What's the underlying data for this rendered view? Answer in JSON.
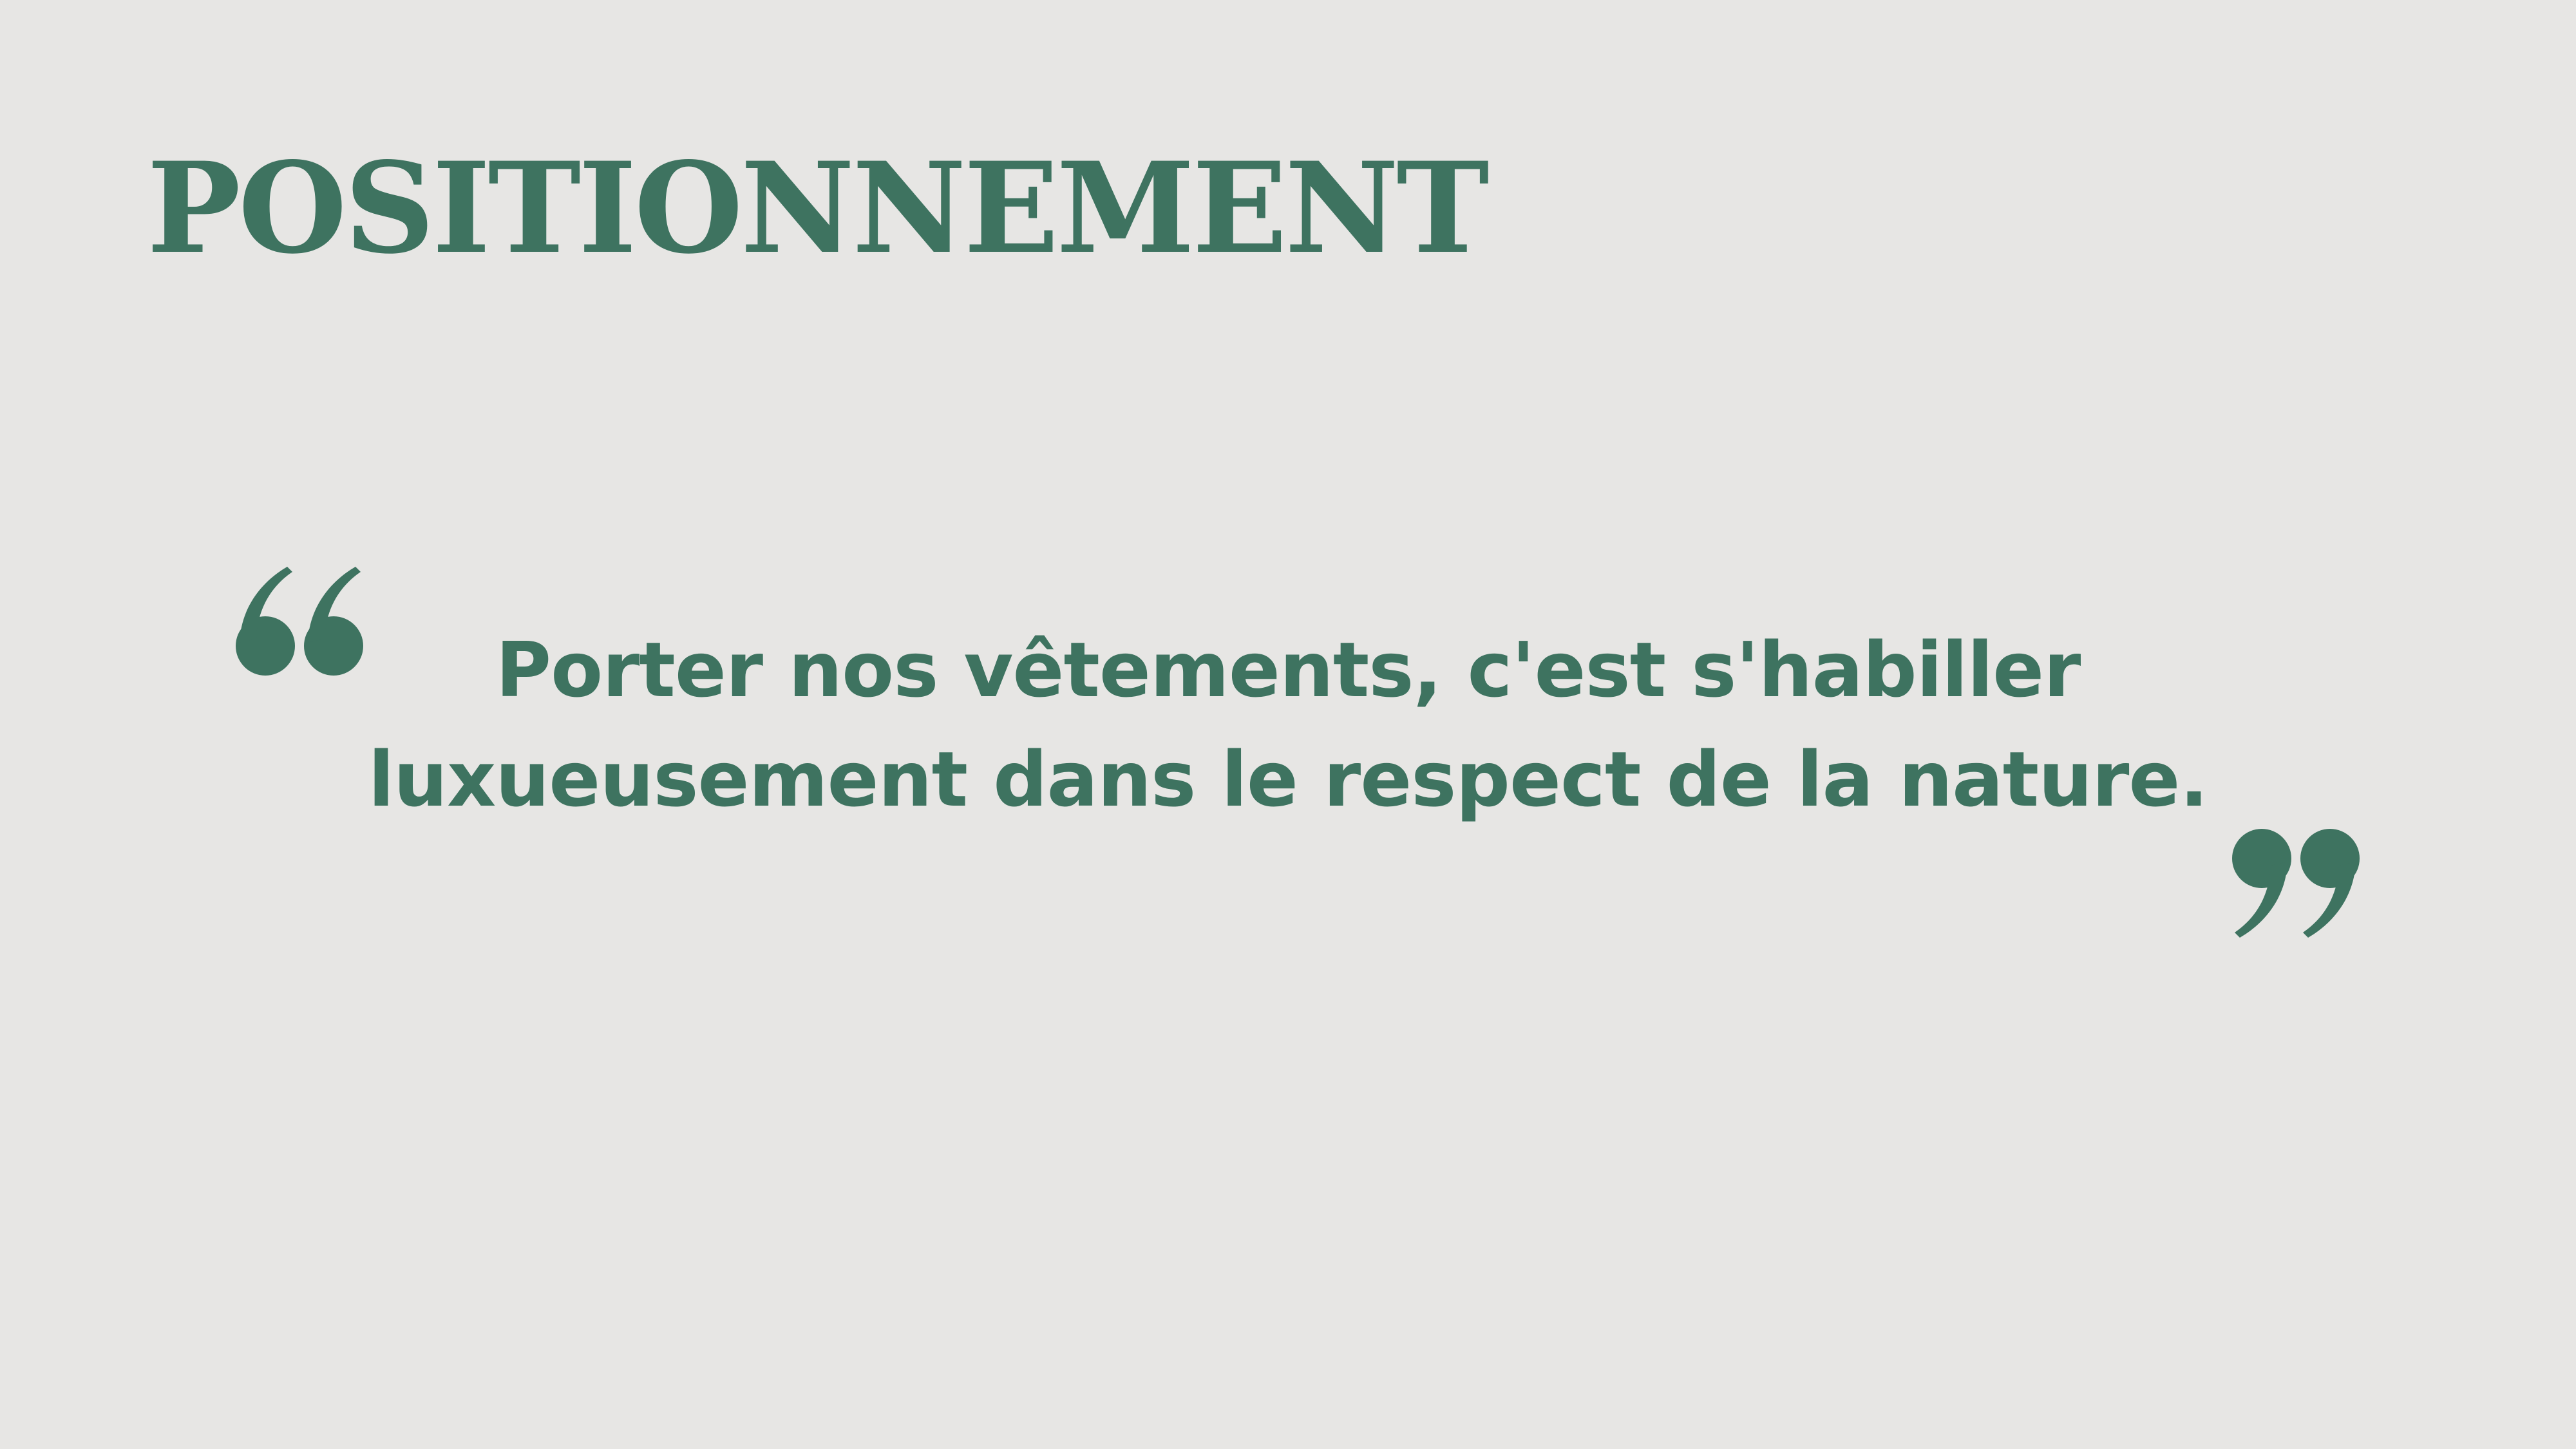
{
  "slide": {
    "title": "POSITIONNEMENT",
    "quote_lines": [
      "Porter nos vêtements, c'est s'habiller",
      "luxueusement dans le respect de la nature."
    ]
  },
  "icons": {
    "open_quote": "open-quote-icon",
    "close_quote": "close-quote-icon"
  },
  "colors": {
    "background": "#e7e6e4",
    "accent": "#3e7360"
  }
}
